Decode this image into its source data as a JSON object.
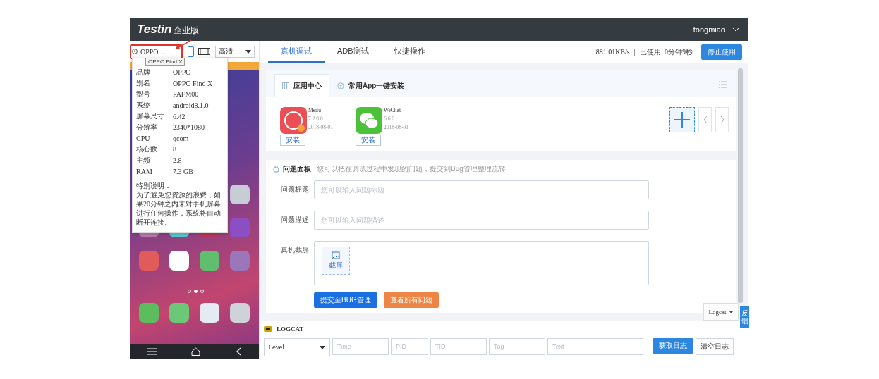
{
  "header": {
    "logo": "Testin",
    "edition": "企业版",
    "user": "tongmiao"
  },
  "device_bar": {
    "device": "OPPO ...",
    "quality": "高清"
  },
  "tooltip": "OPPO Find X",
  "device_info": {
    "rows": [
      {
        "label": "品牌",
        "value": "OPPO"
      },
      {
        "label": "别名",
        "value": "OPPO Find X"
      },
      {
        "label": "型号",
        "value": "PAFM00"
      },
      {
        "label": "系统",
        "value": "android8.1.0"
      },
      {
        "label": "屏幕尺寸",
        "value": "6.42"
      },
      {
        "label": "分辨率",
        "value": "2340*1080"
      },
      {
        "label": "CPU",
        "value": "qcom"
      },
      {
        "label": "核心数",
        "value": "8"
      },
      {
        "label": "主频",
        "value": "2.8"
      },
      {
        "label": "RAM",
        "value": "7.3 GB"
      }
    ],
    "note_title": "特别说明：",
    "note": "为了避免您资源的浪费，如果20分钟之内未对手机屏幕进行任何操作，系统将自动断开连接。"
  },
  "tabs": [
    {
      "label": "真机调试",
      "selected": true
    },
    {
      "label": "ADB测试",
      "selected": false
    },
    {
      "label": "快捷操作",
      "selected": false
    }
  ],
  "stats": {
    "speed": "881.01KB/s",
    "separator": "|",
    "used": "已使用: 0分钟9秒",
    "stop": "停止使用"
  },
  "app_center": {
    "tabs": [
      {
        "label": "应用中心",
        "selected": true,
        "kind": "grid"
      },
      {
        "label": "常用App一键安装",
        "selected": false,
        "kind": "cube"
      }
    ],
    "apps": [
      {
        "kind": "meitu",
        "name": "Meitu",
        "version": "7.2.0.0",
        "date": "2018-08-01",
        "action": "安装"
      },
      {
        "kind": "wechat",
        "name": "WeChat",
        "version": "6.6.0",
        "date": "2018-08-01",
        "action": "安装"
      }
    ]
  },
  "issue_panel": {
    "title": "问题面板",
    "hint": "您可以把在调试过程中发现的问题，提交到Bug管理整理流转",
    "fields": [
      {
        "label": "问题标题",
        "placeholder": "您可以输入问题标题"
      },
      {
        "label": "问题描述",
        "placeholder": "您可以输入问题描述"
      }
    ],
    "screenshot_label": "真机截屏",
    "screenshot_button": "截屏",
    "submit": "提交至BUG管理",
    "view_all": "查看所有问题"
  },
  "logcat_dropdown": "Logcat",
  "feedback": "反馈",
  "logcat": {
    "title": "LOGCAT",
    "level": "Level",
    "placeholders": [
      "Time",
      "PID",
      "TID",
      "Tag",
      "Text"
    ],
    "fetch": "获取日志",
    "clear": "清空日志"
  }
}
